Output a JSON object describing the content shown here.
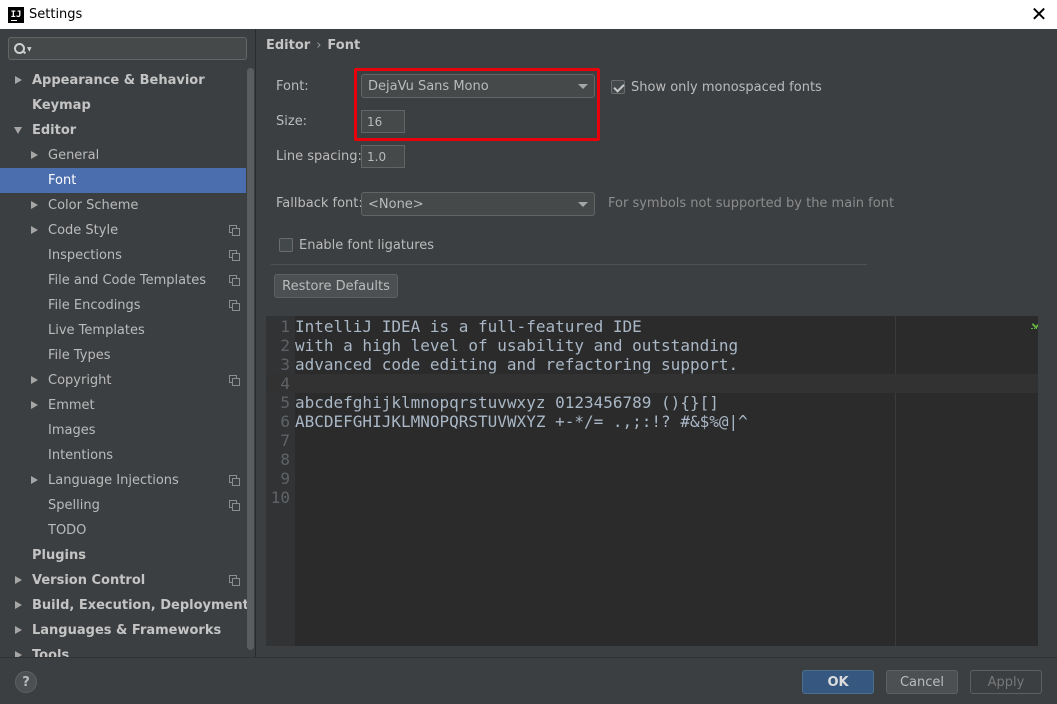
{
  "window": {
    "title": "Settings",
    "app_icon": "IJ"
  },
  "sidebar": {
    "search": {
      "value": "",
      "placeholder": ""
    },
    "items": [
      {
        "label": "Appearance & Behavior",
        "bold": true,
        "arrow": "right",
        "level": 0,
        "copy": false
      },
      {
        "label": "Keymap",
        "bold": true,
        "arrow": "",
        "level": 0,
        "copy": false
      },
      {
        "label": "Editor",
        "bold": true,
        "arrow": "down",
        "level": 0,
        "copy": false
      },
      {
        "label": "General",
        "bold": false,
        "arrow": "right",
        "level": 1,
        "copy": false
      },
      {
        "label": "Font",
        "bold": false,
        "arrow": "",
        "level": 1,
        "copy": false,
        "selected": true
      },
      {
        "label": "Color Scheme",
        "bold": false,
        "arrow": "right",
        "level": 1,
        "copy": false
      },
      {
        "label": "Code Style",
        "bold": false,
        "arrow": "right",
        "level": 1,
        "copy": true
      },
      {
        "label": "Inspections",
        "bold": false,
        "arrow": "",
        "level": 1,
        "copy": true
      },
      {
        "label": "File and Code Templates",
        "bold": false,
        "arrow": "",
        "level": 1,
        "copy": true
      },
      {
        "label": "File Encodings",
        "bold": false,
        "arrow": "",
        "level": 1,
        "copy": true
      },
      {
        "label": "Live Templates",
        "bold": false,
        "arrow": "",
        "level": 1,
        "copy": false
      },
      {
        "label": "File Types",
        "bold": false,
        "arrow": "",
        "level": 1,
        "copy": false
      },
      {
        "label": "Copyright",
        "bold": false,
        "arrow": "right",
        "level": 1,
        "copy": true
      },
      {
        "label": "Emmet",
        "bold": false,
        "arrow": "right",
        "level": 1,
        "copy": false
      },
      {
        "label": "Images",
        "bold": false,
        "arrow": "",
        "level": 1,
        "copy": false
      },
      {
        "label": "Intentions",
        "bold": false,
        "arrow": "",
        "level": 1,
        "copy": false
      },
      {
        "label": "Language Injections",
        "bold": false,
        "arrow": "right",
        "level": 1,
        "copy": true
      },
      {
        "label": "Spelling",
        "bold": false,
        "arrow": "",
        "level": 1,
        "copy": true
      },
      {
        "label": "TODO",
        "bold": false,
        "arrow": "",
        "level": 1,
        "copy": false
      },
      {
        "label": "Plugins",
        "bold": true,
        "arrow": "",
        "level": 0,
        "copy": false
      },
      {
        "label": "Version Control",
        "bold": true,
        "arrow": "right",
        "level": 0,
        "copy": true
      },
      {
        "label": "Build, Execution, Deployment",
        "bold": true,
        "arrow": "right",
        "level": 0,
        "copy": false
      },
      {
        "label": "Languages & Frameworks",
        "bold": true,
        "arrow": "right",
        "level": 0,
        "copy": false
      },
      {
        "label": "Tools",
        "bold": true,
        "arrow": "right",
        "level": 0,
        "copy": false
      }
    ]
  },
  "breadcrumb": {
    "parent": "Editor",
    "separator": "›",
    "current": "Font"
  },
  "form": {
    "font_label": "Font:",
    "font_value": "DejaVu Sans Mono",
    "monospaced_label": "Show only monospaced fonts",
    "monospaced_checked": true,
    "size_label": "Size:",
    "size_value": "16",
    "spacing_label": "Line spacing:",
    "spacing_value": "1.0",
    "fallback_label": "Fallback font:",
    "fallback_value": "<None>",
    "fallback_hint": "For symbols not supported by the main font",
    "ligatures_label": "Enable font ligatures",
    "ligatures_checked": false,
    "restore_label": "Restore Defaults"
  },
  "preview": {
    "lines": [
      {
        "num": "1",
        "text": "IntelliJ IDEA is a full-featured IDE"
      },
      {
        "num": "2",
        "text": "with a high level of usability and outstanding"
      },
      {
        "num": "3",
        "text": "advanced code editing and refactoring support."
      },
      {
        "num": "4",
        "text": ""
      },
      {
        "num": "5",
        "text": "abcdefghijklmnopqrstuvwxyz 0123456789 (){}[]"
      },
      {
        "num": "6",
        "text": "ABCDEFGHIJKLMNOPQRSTUVWXYZ +-*/= .,;:!? #&$%@|^"
      },
      {
        "num": "7",
        "text": ""
      },
      {
        "num": "8",
        "text": ""
      },
      {
        "num": "9",
        "text": ""
      },
      {
        "num": "10",
        "text": ""
      }
    ],
    "current_line": 4
  },
  "buttons": {
    "help": "?",
    "ok": "OK",
    "cancel": "Cancel",
    "apply": "Apply"
  },
  "colors": {
    "accent": "#4b6eaf",
    "highlight": "#e8000b",
    "ok_button": "#365880",
    "editor_bg": "#2b2b2b"
  },
  "icons": {
    "search": "search-icon",
    "copy": "copy-icon",
    "close": "close-icon",
    "check": "check-icon"
  }
}
